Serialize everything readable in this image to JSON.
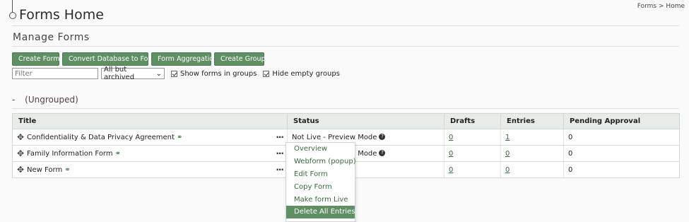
{
  "header": {
    "title": "Forms Home",
    "breadcrumb": [
      "Forms",
      ">",
      "Home"
    ]
  },
  "section": {
    "title": "Manage Forms"
  },
  "toolbar": {
    "buttons": [
      "Create Form",
      "Convert Database to Form",
      "Form Aggregation",
      "Create Group"
    ]
  },
  "filters": {
    "filter_placeholder": "Filter",
    "status_select": "All but archived",
    "show_forms_in_groups": "Show forms in groups",
    "hide_empty_groups": "Hide empty groups"
  },
  "group": {
    "dash": "-",
    "name": "(Ungrouped)"
  },
  "table": {
    "columns": [
      "Title",
      "Status",
      "Drafts",
      "Entries",
      "Pending Approval"
    ],
    "rows": [
      {
        "title": "Confidentiality & Data Privacy Agreement",
        "status": "Not Live - Preview Mode",
        "drafts": "0",
        "entries": "1",
        "pending": "0"
      },
      {
        "title": "Family Information Form",
        "status": "Not Live - Preview Mode",
        "drafts": "0",
        "entries": "0",
        "pending": "0"
      },
      {
        "title": "New Form",
        "status": "",
        "drafts": "0",
        "entries": "0",
        "pending": "0"
      }
    ]
  },
  "context_menu": {
    "items": [
      "Overview",
      "Webform (popup)",
      "Edit Form",
      "Copy Form",
      "Make form Live",
      "Delete All Entries"
    ],
    "active_index": 5
  },
  "colors": {
    "accent": "#5f8f62",
    "header_bg": "#e7ece7",
    "link": "#3a6b3a"
  }
}
